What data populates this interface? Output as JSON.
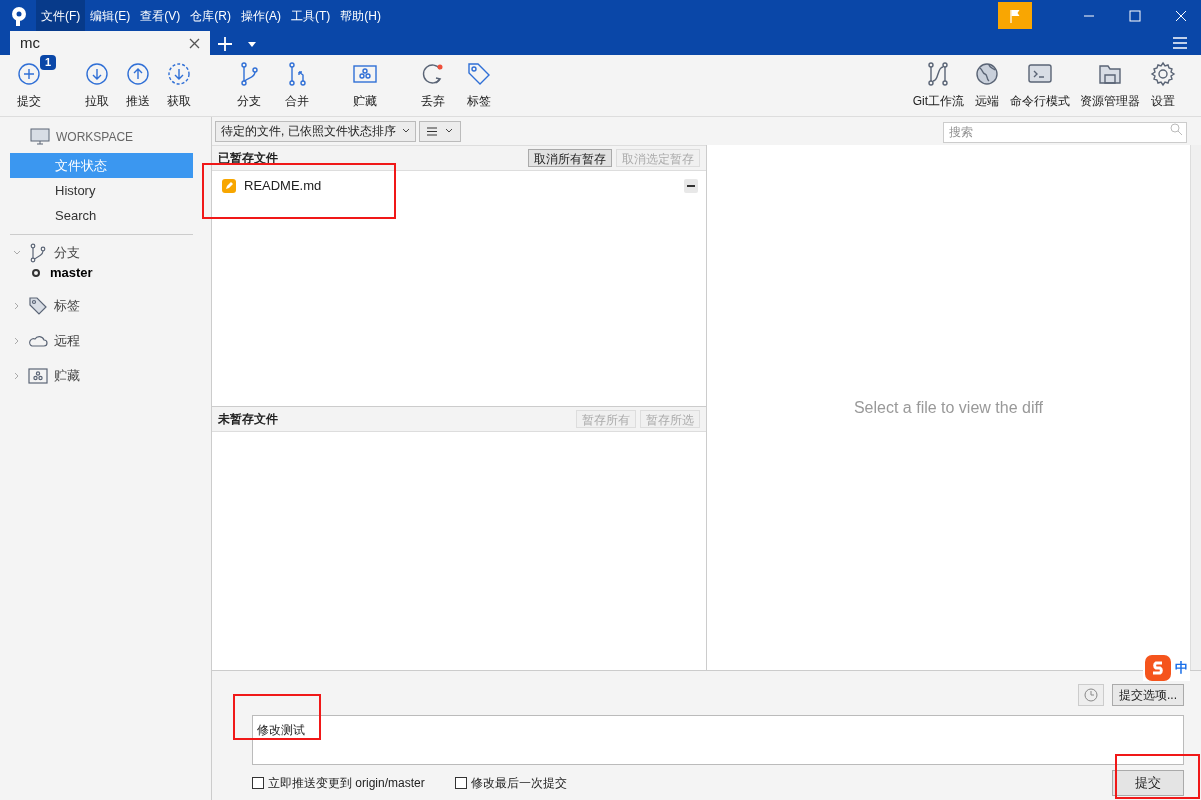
{
  "menu": [
    {
      "label": "文件(F)",
      "selected": true
    },
    {
      "label": "编辑(E)",
      "selected": false
    },
    {
      "label": "查看(V)",
      "selected": false
    },
    {
      "label": "仓库(R)",
      "selected": false
    },
    {
      "label": "操作(A)",
      "selected": false
    },
    {
      "label": "工具(T)",
      "selected": false
    },
    {
      "label": "帮助(H)",
      "selected": false
    }
  ],
  "tabs": [
    {
      "label": "mc",
      "selected": true
    }
  ],
  "toolbar_left": [
    {
      "kind": "commit",
      "label": "提交",
      "badge": "1"
    },
    {
      "kind": "pull",
      "label": "拉取"
    },
    {
      "kind": "push",
      "label": "推送"
    },
    {
      "kind": "fetch",
      "label": "获取"
    },
    {
      "kind": "branch",
      "label": "分支"
    },
    {
      "kind": "merge",
      "label": "合并"
    },
    {
      "kind": "stash",
      "label": "贮藏"
    },
    {
      "kind": "discard",
      "label": "丢弃"
    },
    {
      "kind": "tag",
      "label": "标签"
    }
  ],
  "toolbar_right": [
    {
      "kind": "flow",
      "label": "Git工作流"
    },
    {
      "kind": "remote",
      "label": "远端"
    },
    {
      "kind": "terminal",
      "label": "命令行模式"
    },
    {
      "kind": "explorer",
      "label": "资源管理器"
    },
    {
      "kind": "settings",
      "label": "设置"
    }
  ],
  "sidebar": {
    "workspace": "WORKSPACE",
    "items": [
      {
        "label": "文件状态",
        "selected": true
      },
      {
        "label": "History",
        "selected": false
      },
      {
        "label": "Search",
        "selected": false
      }
    ],
    "sections": [
      {
        "kind": "branch",
        "label": "分支",
        "expanded": true,
        "children": [
          {
            "label": "master",
            "current": true
          }
        ]
      },
      {
        "kind": "tag",
        "label": "标签",
        "expanded": false
      },
      {
        "kind": "remote",
        "label": "远程",
        "expanded": false
      },
      {
        "kind": "stash",
        "label": "贮藏",
        "expanded": false
      }
    ]
  },
  "filter": {
    "value": "待定的文件, 已依照文件状态排序"
  },
  "search": {
    "placeholder": "搜索"
  },
  "staged": {
    "title": "已暂存文件",
    "buttons": [
      {
        "label": "取消所有暂存",
        "disabled": false
      },
      {
        "label": "取消选定暂存",
        "disabled": true
      }
    ],
    "files": [
      {
        "name": "README.md"
      }
    ]
  },
  "unstaged": {
    "title": "未暂存文件",
    "buttons": [
      {
        "label": "暂存所有",
        "disabled": true
      },
      {
        "label": "暂存所选",
        "disabled": true
      }
    ]
  },
  "diff": {
    "message": "Select a file to view the diff"
  },
  "commit": {
    "message": "修改测试",
    "options": "提交选项...",
    "submit": "提交",
    "checks": [
      {
        "label": "立即推送变更到 origin/master",
        "checked": false
      },
      {
        "label": "修改最后一次提交",
        "checked": false
      }
    ]
  },
  "ime": {
    "label": "中"
  }
}
